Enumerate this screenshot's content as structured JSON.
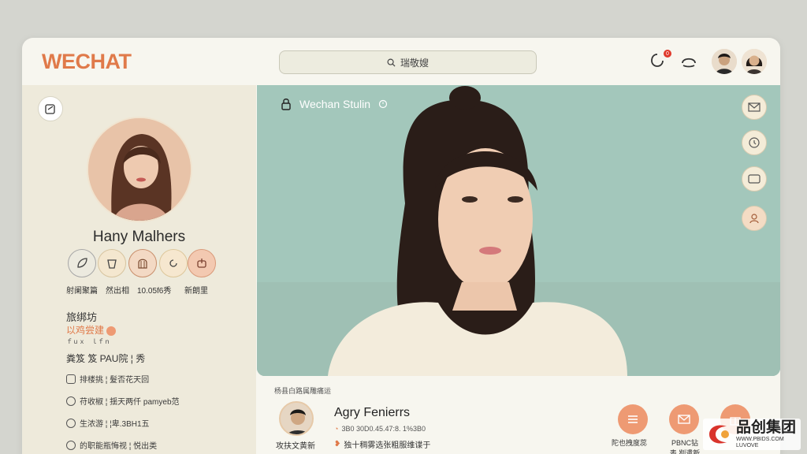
{
  "app": {
    "logo": "WECHAT"
  },
  "header": {
    "search_text": "瑞敬嫂",
    "notification_count": "0"
  },
  "sidebar": {
    "profile_name": "Hany Malhers",
    "quick_actions": [
      {
        "label": "射阑聚篇",
        "icon": "leaf-icon"
      },
      {
        "label": "然出相",
        "icon": "cup-icon"
      },
      {
        "label": "10.05f6秀",
        "icon": "cage-icon"
      },
      {
        "label": "新朗里",
        "icon": "refresh-icon"
      }
    ],
    "section_title": "旅绑坊",
    "orange_text": "以鸡尝建",
    "small_text": "ｆｕｘ　ｌｆｎ",
    "line_title": "粪笈  笈  PAU院 ¦ 秀",
    "items": [
      "排楼挑 ¦  髮否花天回",
      "苻收椒 ¦  揺天两仟 pamyeb范",
      "生浓游 ¦  ¦卑.3BH1五",
      "的职能瓶悔视 ¦  悦出类"
    ]
  },
  "hero": {
    "title": "Wechan Stulin",
    "accent": "#a9cbc0"
  },
  "bottom": {
    "caption": "杨县白路属雕痛运",
    "contact_name": "Agry Fenierrs",
    "avatar_label": "攻扶文黄新",
    "sub_line": "3B0 30D0.45.47:8. 1%3B0",
    "sub_line2": "独十稠雾选张粗服维谍于",
    "actions": [
      {
        "label": "陀也拽度蕊",
        "icon": "list-icon"
      },
      {
        "label": "PBNC钻表 刿遣新",
        "icon": "mail-icon"
      },
      {
        "label": "",
        "icon": "gift-icon"
      }
    ]
  },
  "watermark": {
    "brand": "品创集团",
    "url": "WWW.PBIDS.COM",
    "tag": "LUVOVE"
  },
  "colors": {
    "brand": "#e07a4a",
    "sidebar_bg": "#eeeadb",
    "button_orange": "#ee9a73"
  }
}
